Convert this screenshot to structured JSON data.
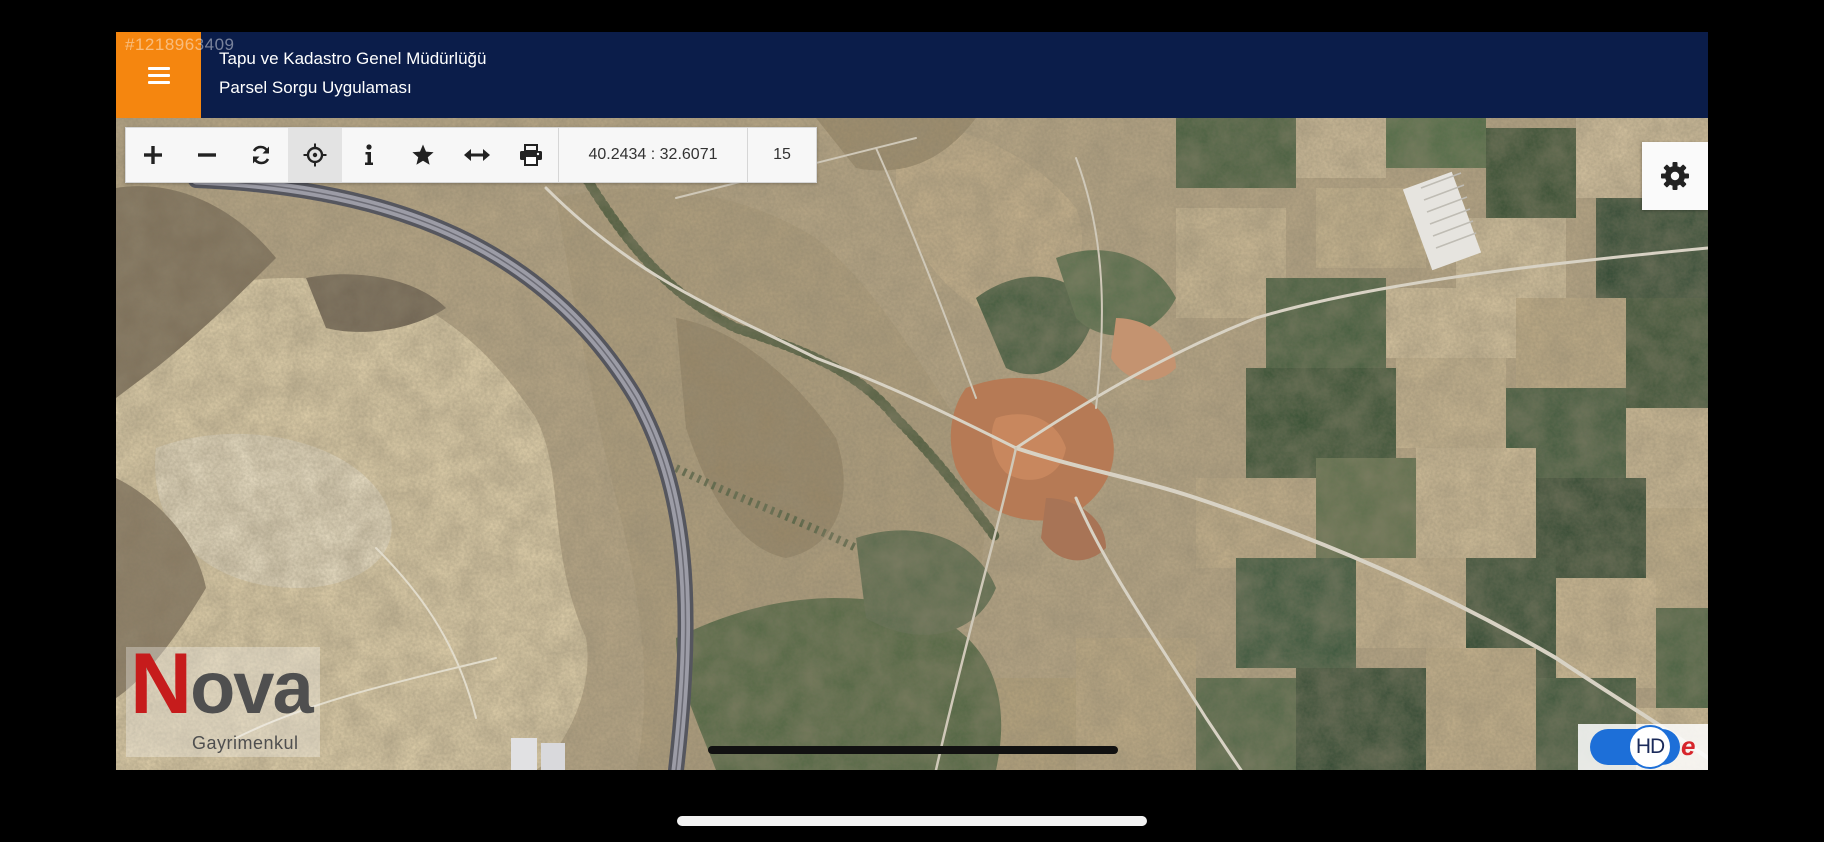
{
  "header": {
    "listing_id": "#1218963409",
    "title": "Tapu ve Kadastro Genel Müdürlüğü",
    "subtitle": "Parsel Sorgu Uygulaması",
    "menu_icon": "hamburger-menu-icon",
    "colors": {
      "bar": "#0b1d4a",
      "menu_button": "#f5860f"
    }
  },
  "toolbar": {
    "tools": [
      {
        "name": "zoom-in",
        "icon": "plus-icon"
      },
      {
        "name": "zoom-out",
        "icon": "minus-icon"
      },
      {
        "name": "refresh",
        "icon": "refresh-icon"
      },
      {
        "name": "locate",
        "icon": "crosshair-icon",
        "active": true
      },
      {
        "name": "info",
        "icon": "info-icon"
      },
      {
        "name": "favorite",
        "icon": "star-icon"
      },
      {
        "name": "measure",
        "icon": "measure-arrows-icon"
      },
      {
        "name": "print",
        "icon": "print-icon"
      }
    ],
    "coordinates": "40.2434 : 32.6071",
    "zoom_level": "15"
  },
  "settings": {
    "icon": "gear-icon"
  },
  "map": {
    "type": "satellite"
  },
  "watermark": {
    "brand_first_letter": "N",
    "brand_rest": "ova",
    "tagline": "Gayrimenkul"
  },
  "hd_badge": {
    "label": "HD",
    "suffix": "e"
  }
}
